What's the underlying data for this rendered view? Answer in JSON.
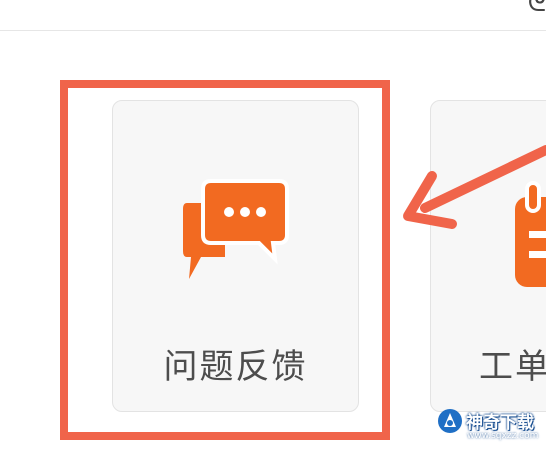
{
  "topbar": {
    "edge_glyph": "ᘓ"
  },
  "tiles": [
    {
      "label": "问题反馈",
      "icon": "chat-bubbles-icon"
    },
    {
      "label": "工单",
      "icon": "clipboard-icon"
    }
  ],
  "annotation": {
    "color": "#f0644a"
  },
  "watermark": {
    "name": "神奇下载",
    "url": "www.sqxzz.com"
  },
  "colors": {
    "accent": "#f26a21",
    "tile_bg": "#f7f7f7"
  }
}
